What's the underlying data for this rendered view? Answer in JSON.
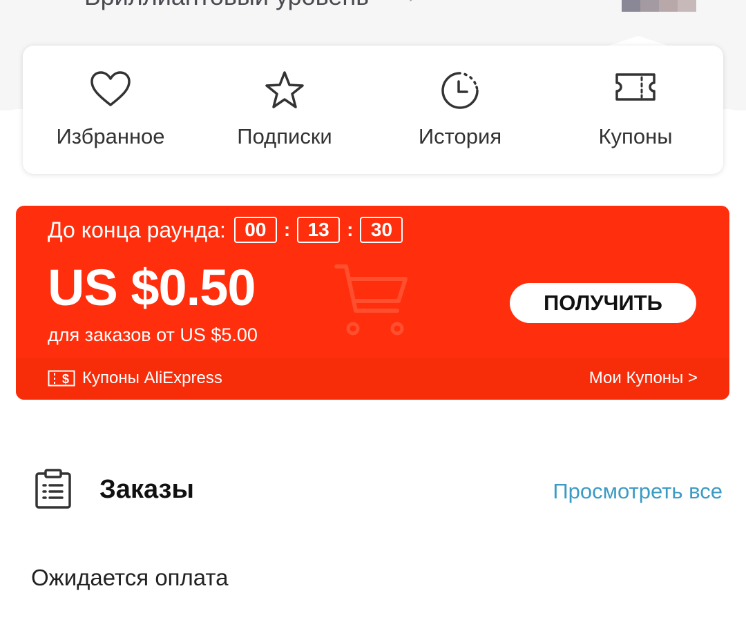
{
  "profile": {
    "level_text": "Бриллиантовый уровень",
    "level_chevron": "›",
    "level_icon": "diamond-level-icon"
  },
  "quick_links": [
    {
      "label": "Избранное",
      "icon": "heart-icon"
    },
    {
      "label": "Подписки",
      "icon": "star-icon"
    },
    {
      "label": "История",
      "icon": "history-clock-icon"
    },
    {
      "label": "Купоны",
      "icon": "ticket-icon"
    }
  ],
  "coupon": {
    "countdown_label": "До конца раунда:",
    "hours": "00",
    "minutes": "13",
    "seconds": "30",
    "separator": ":",
    "amount": "US $0.50",
    "condition": "для заказов от US $5.00",
    "get_button": "ПОЛУЧИТЬ",
    "brand_label": "Купоны AliExpress",
    "my_coupons_link": "Мои Купоны >",
    "accent_color": "#ff2e0c"
  },
  "orders": {
    "title": "Заказы",
    "view_all": "Просмотреть все",
    "awaiting_payment": "Ожидается оплата",
    "link_color": "#3b9bc4"
  }
}
